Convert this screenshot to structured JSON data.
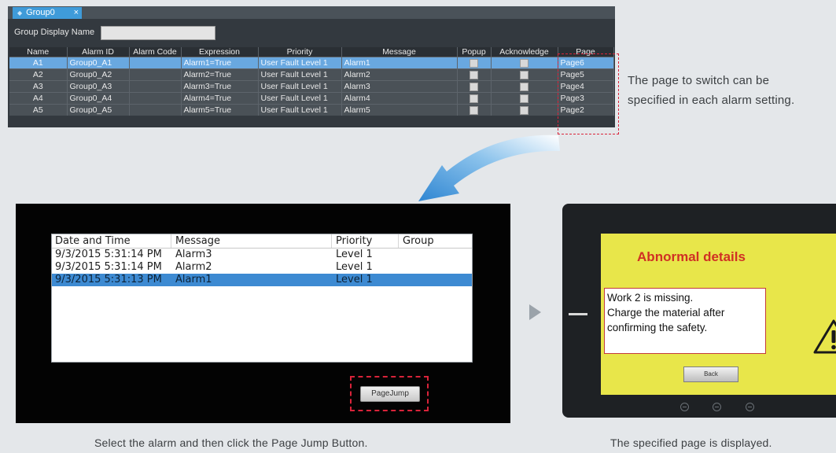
{
  "editor": {
    "tab_label": "Group0",
    "tab_close": "×",
    "group_display_label": "Group Display Name",
    "group_display_value": "",
    "columns": [
      "Name",
      "Alarm ID",
      "Alarm Code",
      "Expression",
      "Priority",
      "Message",
      "Popup",
      "Acknowledge",
      "Page"
    ],
    "rows": [
      {
        "name": "A1",
        "alarm_id": "Group0_A1",
        "alarm_code": "",
        "expression": "Alarm1=True",
        "priority": "User Fault Level 1",
        "message": "Alarm1",
        "page": "Page6",
        "selected": true
      },
      {
        "name": "A2",
        "alarm_id": "Group0_A2",
        "alarm_code": "",
        "expression": "Alarm2=True",
        "priority": "User Fault Level 1",
        "message": "Alarm2",
        "page": "Page5",
        "selected": false
      },
      {
        "name": "A3",
        "alarm_id": "Group0_A3",
        "alarm_code": "",
        "expression": "Alarm3=True",
        "priority": "User Fault Level 1",
        "message": "Alarm3",
        "page": "Page4",
        "selected": false
      },
      {
        "name": "A4",
        "alarm_id": "Group0_A4",
        "alarm_code": "",
        "expression": "Alarm4=True",
        "priority": "User Fault Level 1",
        "message": "Alarm4",
        "page": "Page3",
        "selected": false
      },
      {
        "name": "A5",
        "alarm_id": "Group0_A5",
        "alarm_code": "",
        "expression": "Alarm5=True",
        "priority": "User Fault Level 1",
        "message": "Alarm5",
        "page": "Page2",
        "selected": false
      }
    ]
  },
  "annotation": {
    "line1": "The page to switch can be",
    "line2": "specified in each alarm setting."
  },
  "viewer": {
    "columns": [
      "Date and Time",
      "Message",
      "Priority",
      "Group"
    ],
    "rows": [
      {
        "datetime": "9/3/2015 5:31:14 PM",
        "message": "Alarm3",
        "priority": "Level 1",
        "group": "",
        "selected": false
      },
      {
        "datetime": "9/3/2015 5:31:14 PM",
        "message": "Alarm2",
        "priority": "Level 1",
        "group": "",
        "selected": false
      },
      {
        "datetime": "9/3/2015 5:31:13 PM",
        "message": "Alarm1",
        "priority": "Level 1",
        "group": "",
        "selected": true
      }
    ],
    "page_jump_label": "PageJump"
  },
  "device": {
    "title": "Abnormal details",
    "message_lines": [
      "Work 2 is missing.",
      "Charge the material after",
      "confirming the safety."
    ],
    "back_label": "Back",
    "warning_icon": "warning-triangle-icon"
  },
  "captions": {
    "left": "Select the alarm and then click the Page Jump Button.",
    "right": "The specified page is displayed."
  },
  "colors": {
    "highlight": "#d9233a",
    "selected_row": "#69a8e0",
    "viewer_selected": "#3d8ad2",
    "screen_yellow": "#e8e64a",
    "arrow": "#3a8fd6"
  }
}
